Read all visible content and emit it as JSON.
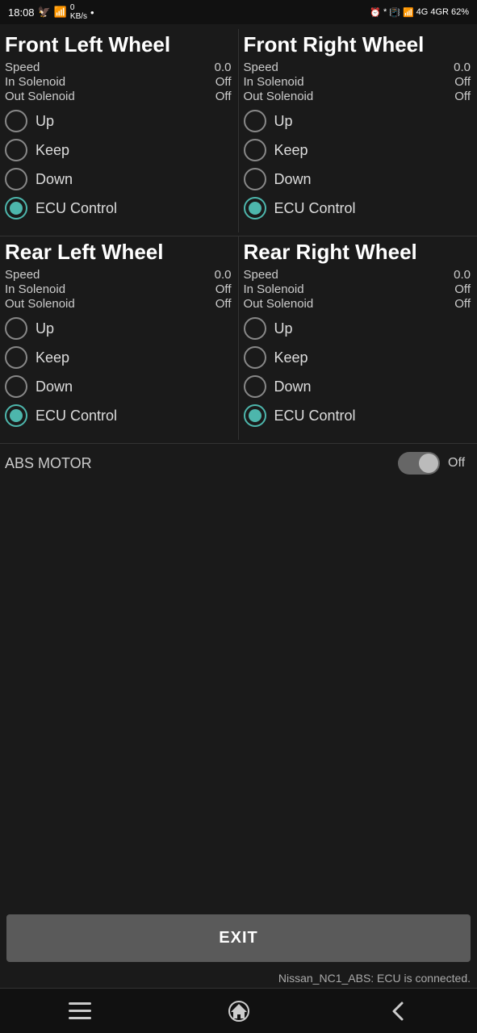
{
  "status_bar": {
    "time": "18:08",
    "battery": "62"
  },
  "wheels": [
    {
      "id": "front-left",
      "title": "Front Left Wheel",
      "speed_label": "Speed",
      "speed_value": "0.0",
      "in_solenoid_label": "In Solenoid",
      "in_solenoid_value": "Off",
      "out_solenoid_label": "Out Solenoid",
      "out_solenoid_value": "Off",
      "options": [
        "Up",
        "Keep",
        "Down",
        "ECU Control"
      ],
      "selected": 3
    },
    {
      "id": "front-right",
      "title": "Front Right Wheel",
      "speed_label": "Speed",
      "speed_value": "0.0",
      "in_solenoid_label": "In Solenoid",
      "in_solenoid_value": "Off",
      "out_solenoid_label": "Out Solenoid",
      "out_solenoid_value": "Off",
      "options": [
        "Up",
        "Keep",
        "Down",
        "ECU Control"
      ],
      "selected": 3
    },
    {
      "id": "rear-left",
      "title": "Rear Left Wheel",
      "speed_label": "Speed",
      "speed_value": "0.0",
      "in_solenoid_label": "In Solenoid",
      "in_solenoid_value": "Off",
      "out_solenoid_label": "Out Solenoid",
      "out_solenoid_value": "Off",
      "options": [
        "Up",
        "Keep",
        "Down",
        "ECU Control"
      ],
      "selected": 3
    },
    {
      "id": "rear-right",
      "title": "Rear Right Wheel",
      "speed_label": "Speed",
      "speed_value": "0.0",
      "in_solenoid_label": "In Solenoid",
      "in_solenoid_value": "Off",
      "out_solenoid_label": "Out Solenoid",
      "out_solenoid_value": "Off",
      "options": [
        "Up",
        "Keep",
        "Down",
        "ECU Control"
      ],
      "selected": 3
    }
  ],
  "abs_motor": {
    "label": "ABS MOTOR",
    "value": "Off",
    "toggle_state": false
  },
  "exit_button_label": "EXIT",
  "ecu_status": "Nissan_NC1_ABS: ECU is connected.",
  "nav": {
    "menu_icon": "☰",
    "home_icon": "⌂",
    "back_icon": "‹"
  }
}
